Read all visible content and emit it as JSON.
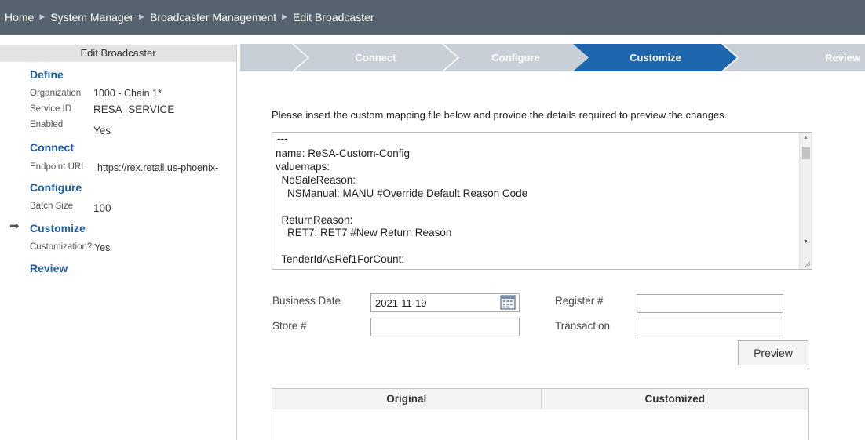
{
  "breadcrumb": {
    "items": [
      "Home",
      "System Manager",
      "Broadcaster Management",
      "Edit Broadcaster"
    ],
    "separator": "▶"
  },
  "sidebar": {
    "title": "Edit Broadcaster",
    "define": {
      "heading": "Define",
      "organization_label": "Organization",
      "organization_value": "1000 - Chain 1*",
      "service_id_label": "Service ID",
      "service_id_value": "RESA_SERVICE",
      "enabled_label": "Enabled",
      "enabled_value": "Yes"
    },
    "connect": {
      "heading": "Connect",
      "endpoint_label": "Endpoint URL",
      "endpoint_value": "https://rex.retail.us-phoenix-"
    },
    "configure": {
      "heading": "Configure",
      "batch_label": "Batch Size",
      "batch_value": "100"
    },
    "customize": {
      "heading": "Customize",
      "custom_label": "Customization?",
      "custom_value": "Yes",
      "current_indicator": "➡"
    },
    "review": {
      "heading": "Review"
    }
  },
  "train": {
    "steps": [
      "Connect",
      "Configure",
      "Customize",
      "Review"
    ],
    "active_index": 2,
    "active_color": "#1e66ae",
    "inactive_color": "#c8cfd6"
  },
  "main": {
    "instruction": "Please insert the custom mapping file below and provide the details required to preview the changes.",
    "mapping_lines": [
      "---",
      "name: ReSA-Custom-Config",
      "valuemaps:",
      "  NoSaleReason:",
      "    NSManual: MANU #Override Default Reason Code",
      "",
      "  ReturnReason:",
      "    RET7: RET7 #New Return Reason",
      "",
      "  TenderIdAsRef1ForCount:"
    ],
    "form": {
      "business_date_label": "Business Date",
      "business_date_value": "2021-11-19",
      "store_label": "Store #",
      "store_value": "",
      "register_label": "Register #",
      "register_value": "",
      "transaction_label": "Transaction",
      "transaction_value": ""
    },
    "preview_button": "Preview",
    "table": {
      "original_header": "Original",
      "customized_header": "Customized"
    }
  }
}
